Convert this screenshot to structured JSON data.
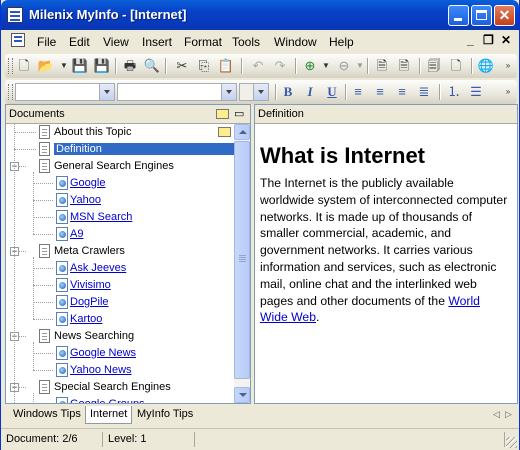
{
  "window": {
    "title": "Milenix MyInfo - [Internet]"
  },
  "menu": [
    "File",
    "Edit",
    "View",
    "Insert",
    "Format",
    "Tools",
    "Window",
    "Help"
  ],
  "format_toolbar": {
    "bold": "B",
    "italic": "I",
    "underline": "U"
  },
  "documents_pane": {
    "header": "Documents",
    "tree": [
      {
        "label": "About this Topic",
        "kind": "doc",
        "level": 1,
        "note": true
      },
      {
        "label": "Definition",
        "kind": "doc",
        "level": 1,
        "selected": true
      },
      {
        "label": "General Search Engines",
        "kind": "doc",
        "level": 0,
        "expanded": true
      },
      {
        "label": "Google",
        "kind": "web",
        "level": 2
      },
      {
        "label": "Yahoo",
        "kind": "web",
        "level": 2
      },
      {
        "label": "MSN Search",
        "kind": "web",
        "level": 2
      },
      {
        "label": "A9",
        "kind": "web",
        "level": 2
      },
      {
        "label": "Meta Crawlers",
        "kind": "doc",
        "level": 0,
        "expanded": true
      },
      {
        "label": "Ask Jeeves",
        "kind": "web",
        "level": 2
      },
      {
        "label": "Vivisimo",
        "kind": "web",
        "level": 2
      },
      {
        "label": "DogPile",
        "kind": "web",
        "level": 2
      },
      {
        "label": "Kartoo",
        "kind": "web",
        "level": 2
      },
      {
        "label": "News Searching",
        "kind": "doc",
        "level": 0,
        "expanded": true
      },
      {
        "label": "Google News",
        "kind": "web",
        "level": 2
      },
      {
        "label": "Yahoo News",
        "kind": "web",
        "level": 2
      },
      {
        "label": "Special Search Engines",
        "kind": "doc",
        "level": 0,
        "expanded": true
      },
      {
        "label": "Google Groups",
        "kind": "web",
        "level": 2
      }
    ]
  },
  "editor": {
    "header": "Definition",
    "heading": "What is Internet",
    "body": "The Internet is the publicly available worldwide system of interconnected computer networks. It is made up of thousands of smaller commercial, academic, and government networks. It carries various information and services, such as electronic mail, online chat and the interlinked web pages and other documents of the ",
    "link": "World Wide Web",
    "tail": "."
  },
  "tabs": [
    "Windows Tips",
    "Internet",
    "MyInfo Tips"
  ],
  "active_tab": 1,
  "status": {
    "document": "Document: 2/6",
    "level": "Level: 1"
  }
}
